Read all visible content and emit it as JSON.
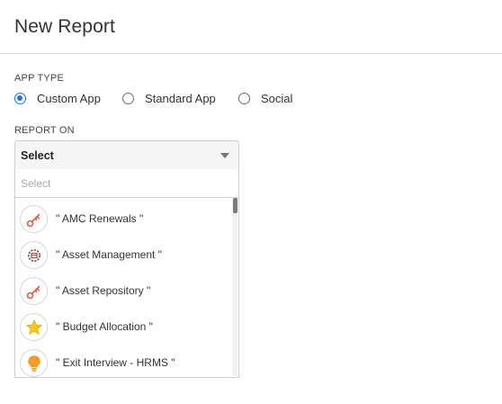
{
  "page": {
    "title": "New Report"
  },
  "app_type": {
    "label": "APP TYPE",
    "options": [
      {
        "label": "Custom App",
        "selected": true
      },
      {
        "label": "Standard App",
        "selected": false
      },
      {
        "label": "Social",
        "selected": false
      }
    ]
  },
  "report_on": {
    "label": "REPORT ON",
    "selected_value": "Select",
    "search_placeholder": "Select",
    "items": [
      {
        "label": "\" AMC Renewals \"",
        "icon": "key-icon"
      },
      {
        "label": "\" Asset Management \"",
        "icon": "gear-box-icon"
      },
      {
        "label": "\" Asset Repository \"",
        "icon": "key-icon"
      },
      {
        "label": "\" Budget Allocation \"",
        "icon": "star-icon"
      },
      {
        "label": "\" Exit Interview - HRMS \"",
        "icon": "lightbulb-icon"
      }
    ]
  },
  "colors": {
    "accent": "#1a73e8",
    "key": "#e2583e",
    "star": "#f5c518",
    "bulb": "#f59a23"
  }
}
